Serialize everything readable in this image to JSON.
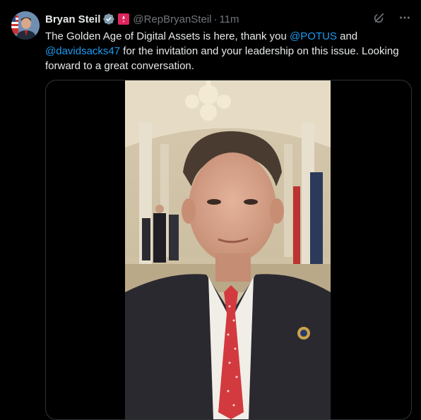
{
  "author": {
    "display_name": "Bryan Steil",
    "handle": "@RepBryanSteil",
    "separator": "·",
    "time": "11m",
    "verified_icon": "verified-badge-icon",
    "affiliation_icon": "government-label-icon"
  },
  "tweet": {
    "text_1": "The Golden Age of Digital Assets is here, thank you ",
    "mention_1": "@POTUS",
    "text_2": " and ",
    "mention_2": "@davidsacks47",
    "text_3": " for the invitation and your leadership on this issue. Looking forward to a great conversation."
  },
  "actions": {
    "grok_icon": "grok-icon",
    "more_icon": "more-options-icon"
  },
  "media": {
    "type": "video",
    "subject": "selfie-video"
  },
  "colors": {
    "background": "#000000",
    "text": "#e7e9ea",
    "secondary": "#71767b",
    "link": "#1d9bf0",
    "verified": "#829aab",
    "affiliation": "#e0245e"
  }
}
